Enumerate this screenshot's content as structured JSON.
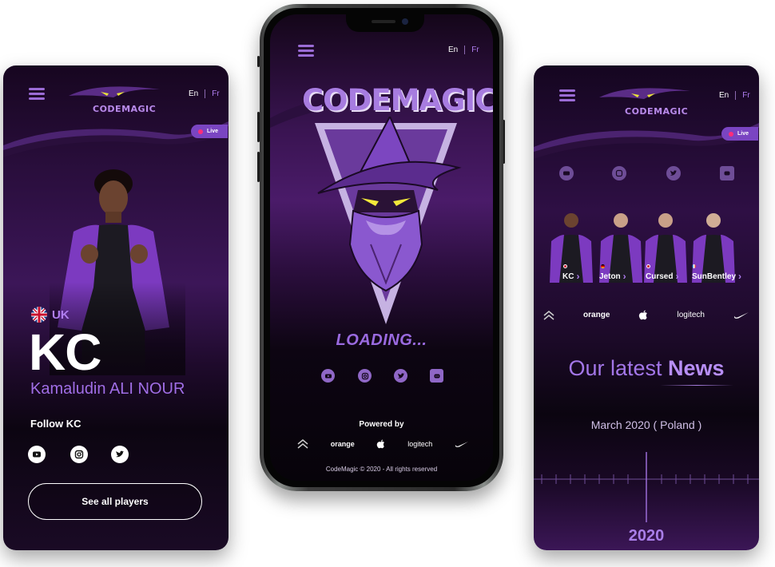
{
  "header": {
    "lang_en": "En",
    "lang_fr": "Fr"
  },
  "brand": {
    "name": "CODEMAGIC"
  },
  "live": {
    "label": "Live",
    "dot_color": "#ff2d7a"
  },
  "player_screen": {
    "country": "UK",
    "code": "KC",
    "full_name": "Kamaludin ALI NOUR",
    "follow_label": "Follow KC",
    "socials": [
      "youtube-icon",
      "instagram-icon",
      "twitter-icon"
    ],
    "see_all_label": "See all players"
  },
  "loading_screen": {
    "loading_text": "LOADING...",
    "socials": [
      "youtube-icon",
      "instagram-icon",
      "twitter-icon",
      "discord-icon"
    ],
    "powered_by": "Powered by",
    "sponsors": [
      "orange",
      "logitech"
    ],
    "copyright": "CodeMagic © 2020 -  All rights reserved"
  },
  "team_screen": {
    "socials": [
      "youtube-icon",
      "instagram-icon",
      "twitter-icon",
      "discord-icon"
    ],
    "players": [
      {
        "name": "KC"
      },
      {
        "name": "Jeton"
      },
      {
        "name": "Cursed"
      },
      {
        "name": "SunBentley"
      }
    ],
    "sponsors": [
      "orange",
      "logitech"
    ],
    "news_title_light": "Our latest",
    "news_title_bold": "News",
    "news_date": "March 2020 ( Poland )",
    "year": "2020"
  },
  "colors": {
    "accent": "#9b6cd6",
    "accent_light": "#b07ef0",
    "live_badge": "#7a45c2"
  }
}
